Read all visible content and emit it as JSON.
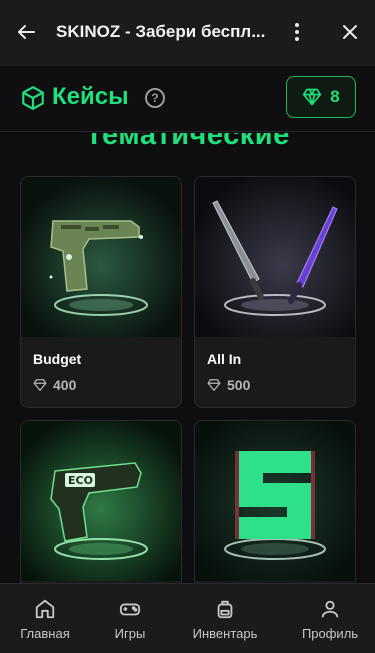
{
  "topbar": {
    "title": "SKINOZ - Забери беспл...",
    "back_icon": "arrow-left-icon",
    "more_icon": "more-vertical-icon",
    "close_icon": "close-icon"
  },
  "header": {
    "title": "Кейсы",
    "help_symbol": "?",
    "balance": "8",
    "accent": "#1fe07a"
  },
  "section": {
    "title": "Тематические"
  },
  "cards": [
    {
      "name": "Budget",
      "price": "400"
    },
    {
      "name": "All In",
      "price": "500"
    },
    {
      "name": "",
      "price": ""
    },
    {
      "name": "",
      "price": ""
    }
  ],
  "bottom_nav": [
    {
      "label": "Главная",
      "icon": "home-icon"
    },
    {
      "label": "Игры",
      "icon": "gamepad-icon"
    },
    {
      "label": "Инвентарь",
      "icon": "backpack-icon"
    },
    {
      "label": "Профиль",
      "icon": "user-icon"
    }
  ]
}
